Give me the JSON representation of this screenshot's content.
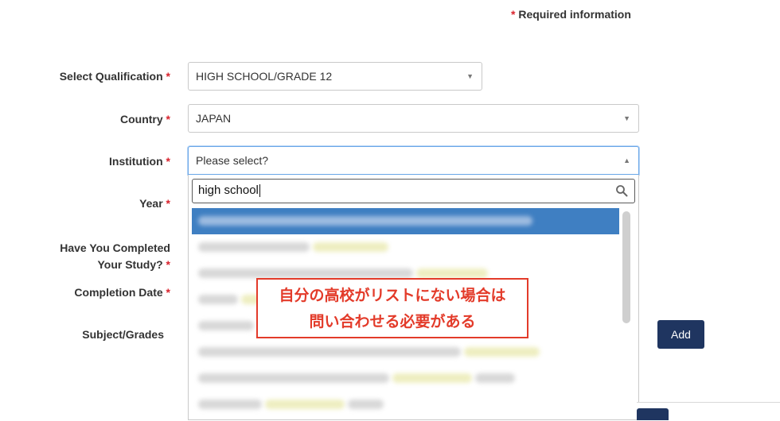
{
  "required_info": {
    "star": "*",
    "text": " Required information"
  },
  "form": {
    "qualification": {
      "label": "Select Qualification",
      "value": "HIGH SCHOOL/GRADE 12"
    },
    "country": {
      "label": "Country",
      "value": "JAPAN"
    },
    "institution": {
      "label": "Institution",
      "placeholder": "Please select?"
    },
    "year": {
      "label": "Year"
    },
    "completed": {
      "label_line1": "Have You Completed",
      "label_line2": "Your Study?"
    },
    "completion_date": {
      "label": "Completion Date"
    },
    "subject_grades": {
      "label": "Subject/Grades"
    },
    "required_star": "*"
  },
  "dropdown": {
    "search_value": "high school",
    "results_count": 8
  },
  "callout": {
    "line1": "自分の高校がリストにない場合は",
    "line2": "問い合わせる必要がある"
  },
  "buttons": {
    "add_label": "Add"
  },
  "icons": {
    "search": "magnifier-icon",
    "select_arrow": "triangle-down-icon",
    "select_arrow_open": "triangle-up-icon"
  },
  "colors": {
    "required": "#d9232d",
    "primary": "#1f3560",
    "highlight": "#3f7fc2",
    "callout": "#e33b2a",
    "focus": "#6aa7e8"
  }
}
